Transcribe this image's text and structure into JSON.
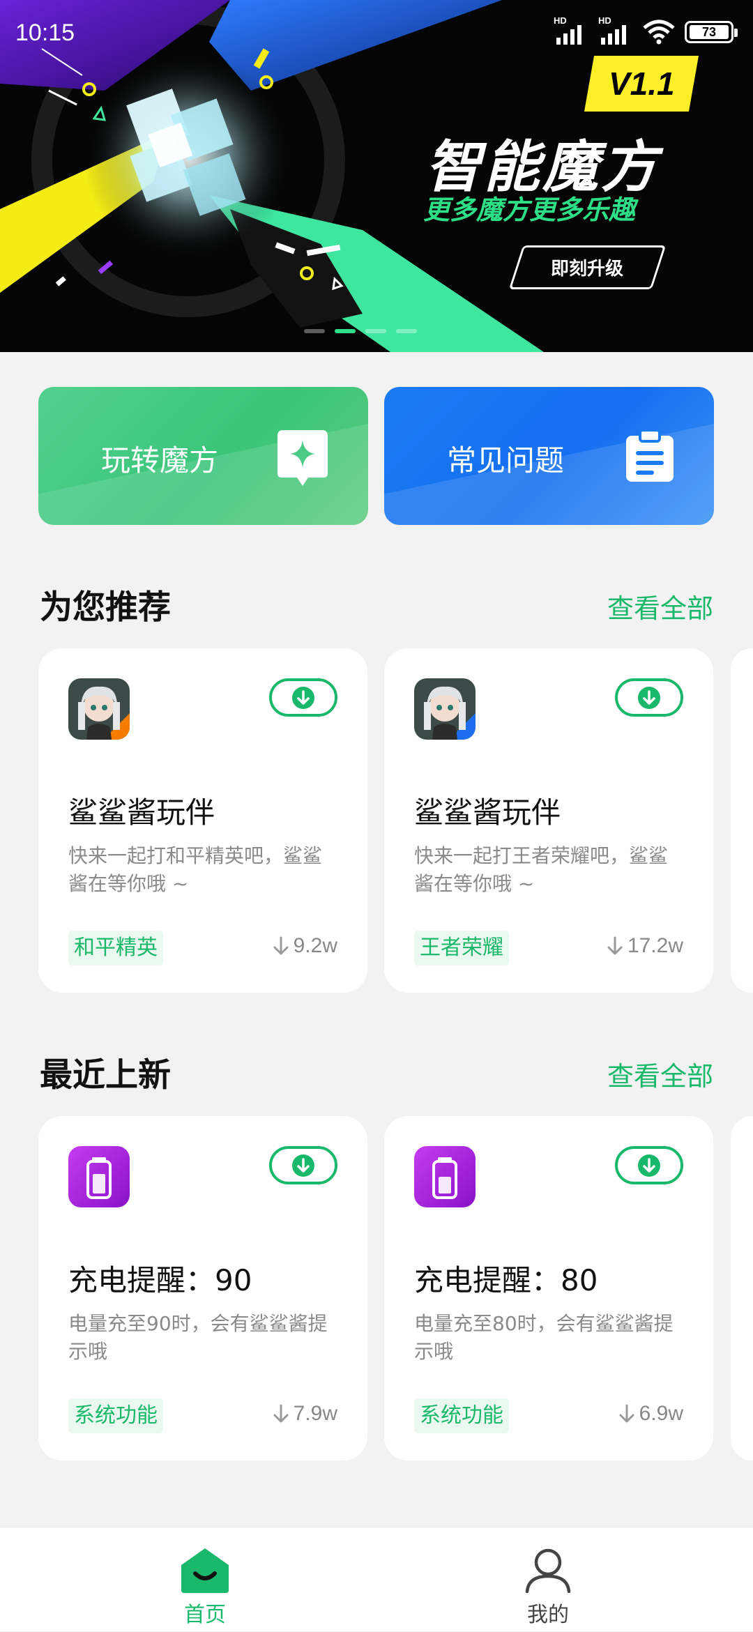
{
  "status_bar": {
    "time": "10:15",
    "signal_1_label": "HD",
    "signal_2_label": "HD",
    "battery": "73"
  },
  "banner": {
    "version": "V1.1",
    "title": "智能魔方",
    "subtitle": "更多魔方更多乐趣",
    "button": "即刻升级",
    "pages": 4,
    "active_page": 2
  },
  "quick_tiles": [
    {
      "label": "玩转魔方",
      "icon": "sparkle-icon",
      "color": "#4ccb86"
    },
    {
      "label": "常见问题",
      "icon": "clipboard-icon",
      "color": "#1a7bf2"
    }
  ],
  "sections": [
    {
      "title": "为您推荐",
      "more": "查看全部",
      "cards": [
        {
          "name": "鲨鲨酱玩伴",
          "desc": "快来一起打和平精英吧，鲨鲨酱在等你哦 ~",
          "tag": "和平精英",
          "downloads": "9.2w",
          "icon": "avatar-icon",
          "accent": "#f57c00"
        },
        {
          "name": "鲨鲨酱玩伴",
          "desc": "快来一起打王者荣耀吧，鲨鲨酱在等你哦 ~",
          "tag": "王者荣耀",
          "downloads": "17.2w",
          "icon": "avatar-icon",
          "accent": "#1e6ff0"
        }
      ]
    },
    {
      "title": "最近上新",
      "more": "查看全部",
      "cards": [
        {
          "name": "充电提醒：90",
          "desc": "电量充至90时，会有鲨鲨酱提示哦",
          "tag": "系统功能",
          "downloads": "7.9w",
          "icon": "battery-icon",
          "accent": "#a020d8"
        },
        {
          "name": "充电提醒：80",
          "desc": "电量充至80时，会有鲨鲨酱提示哦",
          "tag": "系统功能",
          "downloads": "6.9w",
          "icon": "battery-icon",
          "accent": "#a020d8"
        }
      ]
    }
  ],
  "bottom_nav": {
    "home": "首页",
    "mine": "我的"
  },
  "colors": {
    "accent_green": "#1ab86a",
    "page_bg": "#f2f2f2"
  }
}
